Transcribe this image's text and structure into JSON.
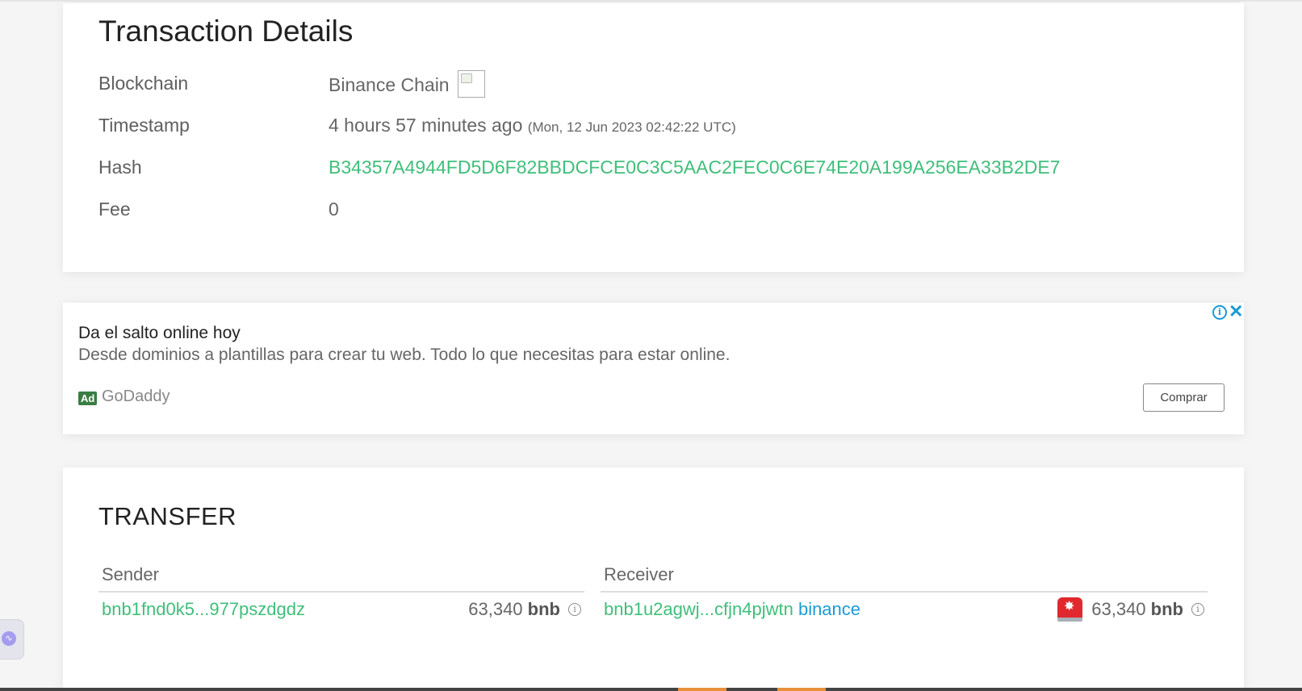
{
  "details": {
    "title": "Transaction Details",
    "rows": [
      {
        "label": "Blockchain",
        "value": "Binance Chain"
      },
      {
        "label": "Timestamp",
        "value": "4 hours 57 minutes ago",
        "note": "(Mon, 12 Jun 2023 02:42:22 UTC)"
      },
      {
        "label": "Hash",
        "value": "B34357A4944FD5D6F82BBDCFCE0C3C5AAC2FEC0C6E74E20A199A256EA33B2DE7"
      },
      {
        "label": "Fee",
        "value": "0"
      }
    ]
  },
  "ad": {
    "title": "Da el salto online hoy",
    "description": "Desde dominios a plantillas para crear tu web. Todo lo que necesitas para estar online.",
    "badge": "Ad",
    "brand": "GoDaddy",
    "button": "Comprar",
    "info_icon": "i",
    "close_icon": "✕"
  },
  "transfer": {
    "title": "TRANSFER",
    "sender": {
      "header": "Sender",
      "address": "bnb1fnd0k5...977pszdgdz",
      "amount": "63,340",
      "unit": "bnb"
    },
    "receiver": {
      "header": "Receiver",
      "address": "bnb1u2agwj...cfjn4pjwtn",
      "tag": "binance",
      "amount": "63,340",
      "unit": "bnb"
    },
    "info_icon": "i"
  },
  "colors": {
    "link_green": "#3fbf7a",
    "tag_blue": "#1a9bd7",
    "ad_badge": "#3a7d44",
    "alert_red": "#e0282e"
  }
}
